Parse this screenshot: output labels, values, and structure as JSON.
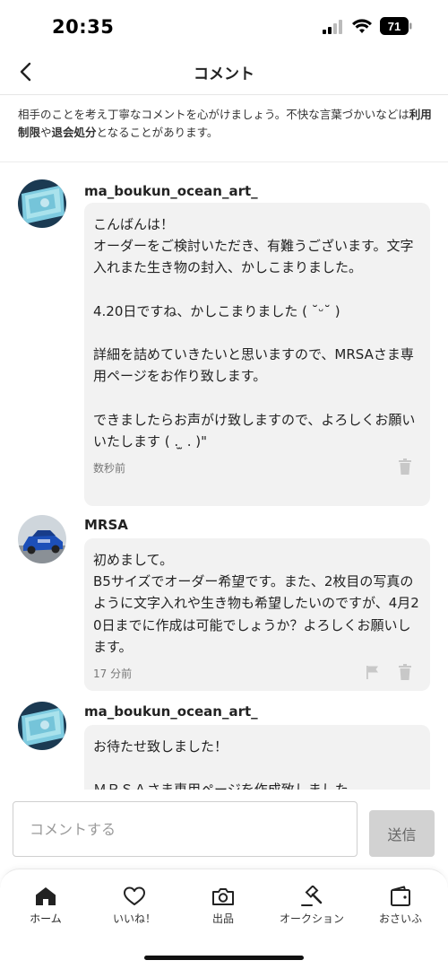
{
  "status_bar": {
    "time": "20:35",
    "battery": "71"
  },
  "header": {
    "title": "コメント"
  },
  "notice": {
    "part1": "相手のことを考え丁寧なコメントを心がけましょう。不快な言葉づかいなどは",
    "strong1": "利用制限",
    "part2": "や",
    "strong2": "退会処分",
    "part3": "となることがあります。"
  },
  "comments": [
    {
      "username": "ma_boukun_ocean_art_",
      "text": "こんばんは！\nオーダーをご検討いただき、有難うございます。文字入れまた生き物の封入、かしこまりました。\n\n4.20日ですね、かしこまりました ( ˘ᵕ˘ )\n\n詳細を詰めていきたいと思いますので、MRSAさま専用ページをお作り致します。\n\nできましたらお声がけ致しますので、よろしくお願いいたします ( . ̫ . )\"",
      "time": "数秒前"
    },
    {
      "username": "MRSA",
      "text": "初めまして。\nB5サイズでオーダー希望です。また、2枚目の写真のように文字入れや生き物も希望したいのですが、4月20日までに作成は可能でしょうか？よろしくお願いします。",
      "time": "17 分前"
    },
    {
      "username": "ma_boukun_ocean_art_",
      "text": "お待たせ致しました！\n\nＭＲＳＡさま専用ページを作成致しました。"
    }
  ],
  "input": {
    "placeholder": "コメントする",
    "send_label": "送信"
  },
  "tabs": [
    {
      "label": "ホーム",
      "icon": "home-icon"
    },
    {
      "label": "いいね！",
      "icon": "heart-icon"
    },
    {
      "label": "出品",
      "icon": "camera-icon"
    },
    {
      "label": "オークション",
      "icon": "gavel-icon"
    },
    {
      "label": "おさいふ",
      "icon": "wallet-icon"
    }
  ],
  "colors": {
    "bubble": "#f2f2f2",
    "send_disabled": "#d2d2d2",
    "text": "#222222"
  }
}
